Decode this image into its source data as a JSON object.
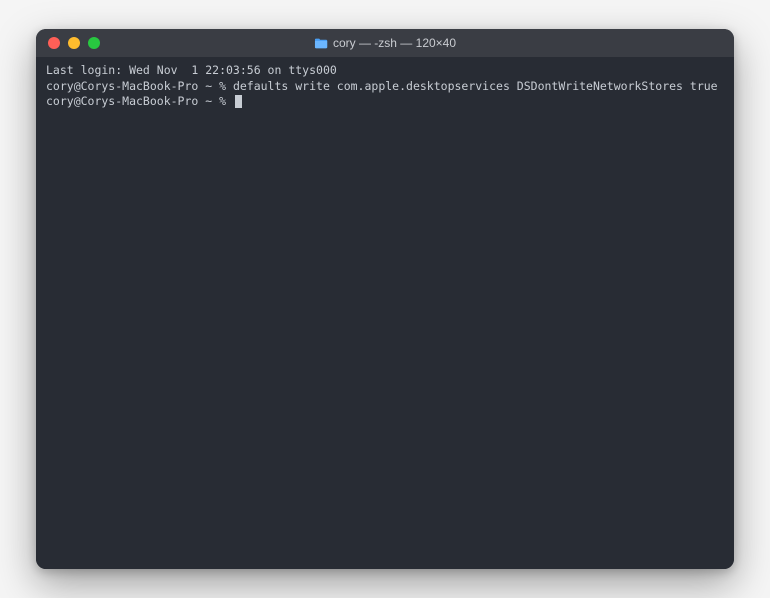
{
  "window": {
    "title": "cory — -zsh — 120×40"
  },
  "terminal": {
    "last_login": "Last login: Wed Nov  1 22:03:56 on ttys000",
    "prompt1_user": "cory@Corys-MacBook-Pro ~ % ",
    "command1": "defaults write com.apple.desktopservices DSDontWriteNetworkStores true",
    "prompt2_user": "cory@Corys-MacBook-Pro ~ % "
  }
}
